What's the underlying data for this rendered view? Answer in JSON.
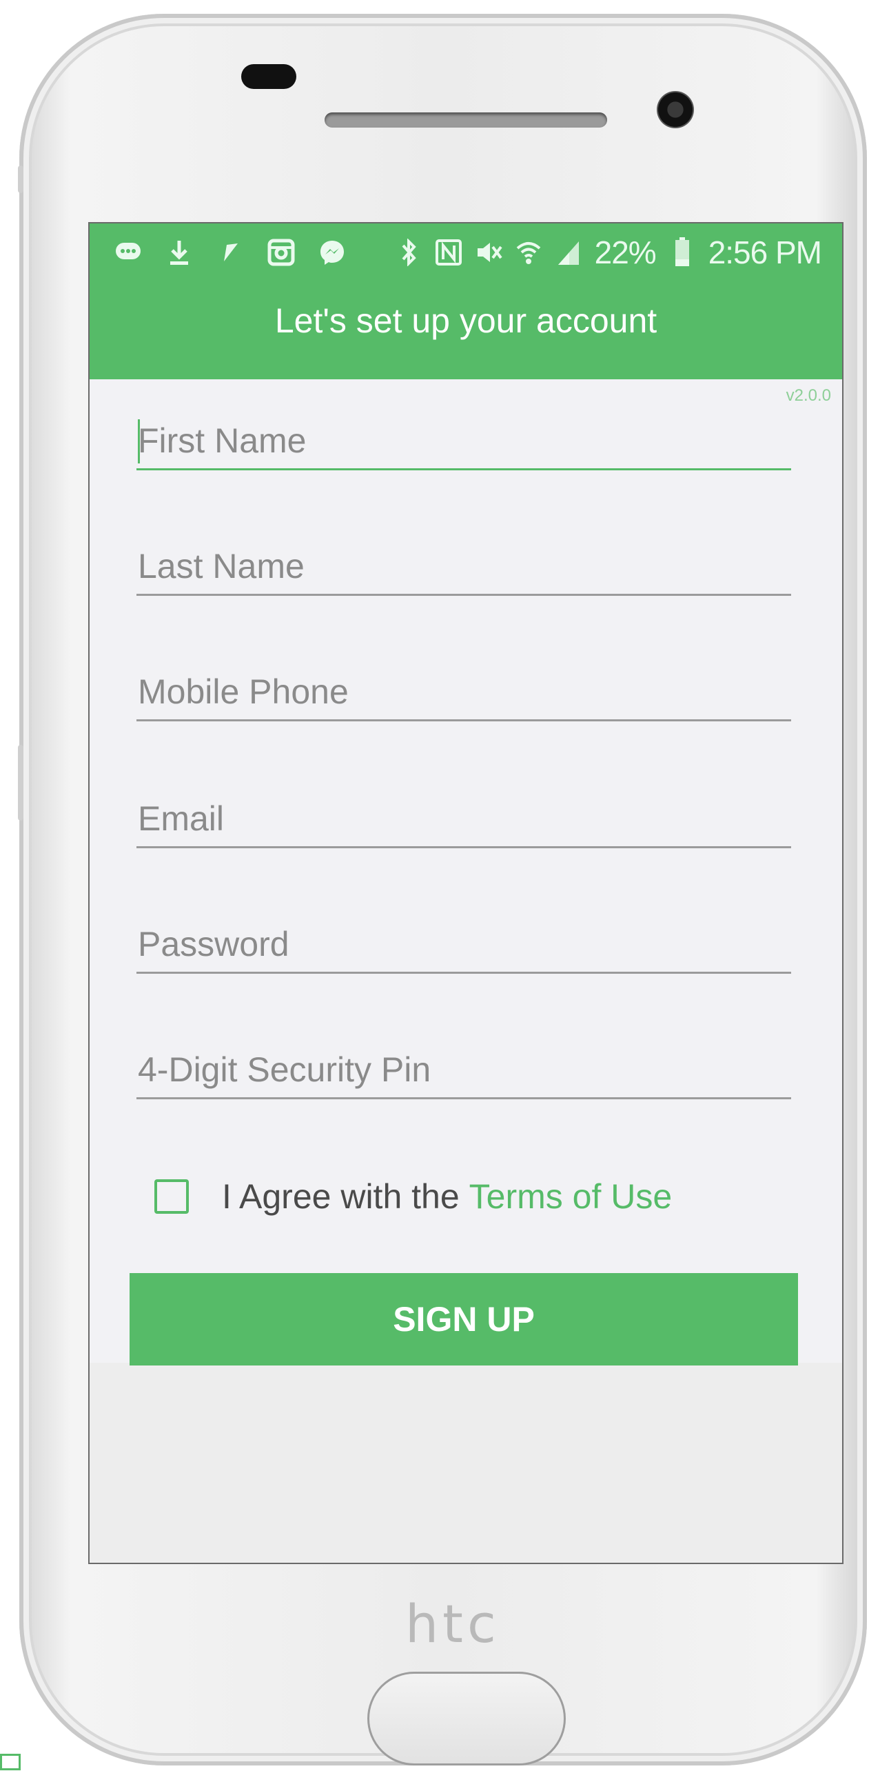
{
  "status_bar": {
    "left_icons": [
      "message-icon",
      "download-icon",
      "send-icon",
      "instagram-icon",
      "messenger-icon"
    ],
    "right_icons": [
      "bluetooth-icon",
      "nfc-icon",
      "mute-icon",
      "wifi-icon",
      "signal-icon",
      "battery-icon"
    ],
    "battery": "22%",
    "time": "2:56 PM"
  },
  "header": {
    "title": "Let's set up your account"
  },
  "version": "v2.0.0",
  "form": {
    "first_name": {
      "placeholder": "First Name"
    },
    "last_name": {
      "placeholder": "Last Name"
    },
    "mobile_phone": {
      "placeholder": "Mobile Phone"
    },
    "email": {
      "placeholder": "Email"
    },
    "password": {
      "placeholder": "Password"
    },
    "security_pin": {
      "placeholder": "4-Digit Security Pin"
    },
    "agree_label": "I Agree with the",
    "terms_link": "Terms of Use",
    "signup_label": "SIGN UP"
  },
  "device": {
    "brand": "htc"
  },
  "colors": {
    "accent": "#56bb68",
    "form_bg": "#f2f2f5",
    "hint": "#8a8a8a"
  }
}
